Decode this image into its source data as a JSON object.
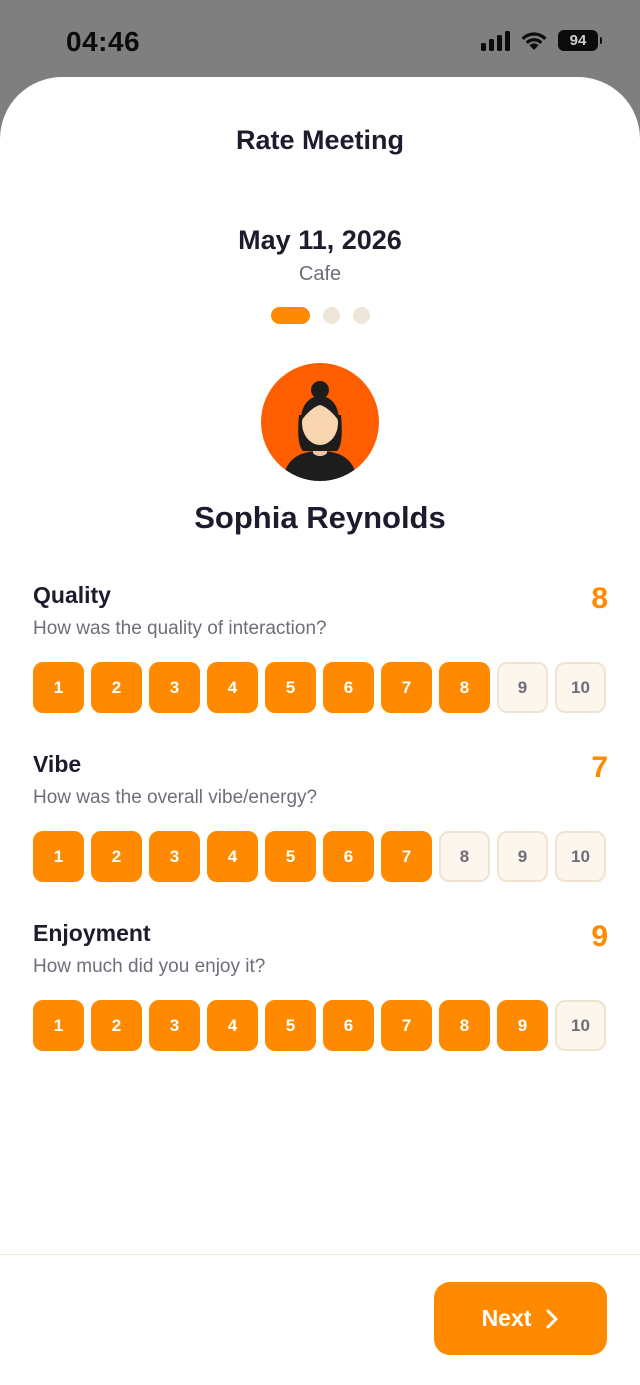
{
  "status_bar": {
    "time": "04:46",
    "battery": "94"
  },
  "sheet": {
    "title": "Rate Meeting"
  },
  "meeting": {
    "date": "May 11, 2026",
    "place": "Cafe"
  },
  "pager": {
    "current": 1,
    "total": 3
  },
  "person": {
    "name": "Sophia Reynolds"
  },
  "ratings": [
    {
      "label": "Quality",
      "question": "How was the quality of interaction?",
      "value": 8,
      "value_text": "8"
    },
    {
      "label": "Vibe",
      "question": "How was the overall vibe/energy?",
      "value": 7,
      "value_text": "7"
    },
    {
      "label": "Enjoyment",
      "question": "How much did you enjoy it?",
      "value": 9,
      "value_text": "9"
    }
  ],
  "scale": [
    "1",
    "2",
    "3",
    "4",
    "5",
    "6",
    "7",
    "8",
    "9",
    "10"
  ],
  "footer": {
    "next_label": "Next"
  },
  "colors": {
    "accent": "#ff8a00",
    "avatar_bg": "#ff5e00",
    "inactive_bg": "#fdf6ec",
    "text_dark": "#1c1c2e",
    "text_muted": "#6e6e7a"
  },
  "icons": {
    "signal": "cellular-signal-icon",
    "wifi": "wifi-icon",
    "battery": "battery-icon",
    "next": "chevron-right-icon"
  }
}
